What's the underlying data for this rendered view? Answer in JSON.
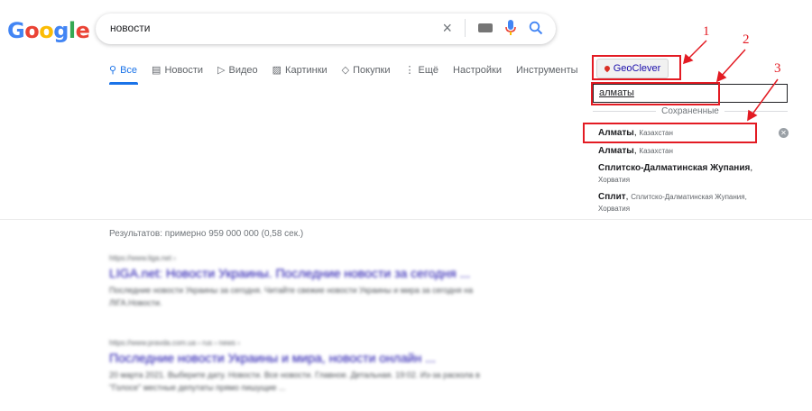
{
  "logo": {
    "letters": [
      "G",
      "o",
      "o",
      "g",
      "l",
      "e"
    ],
    "colors": [
      "#4285f4",
      "#ea4335",
      "#fbbc05",
      "#4285f4",
      "#34a853",
      "#ea4335"
    ]
  },
  "search": {
    "query": "новости",
    "icons": [
      "close-icon",
      "keyboard-icon",
      "microphone-icon",
      "search-icon"
    ]
  },
  "tabs": [
    {
      "label": "Все",
      "icon": "search-icon",
      "active": true
    },
    {
      "label": "Новости",
      "icon": "news-icon"
    },
    {
      "label": "Видео",
      "icon": "video-icon"
    },
    {
      "label": "Картинки",
      "icon": "image-icon"
    },
    {
      "label": "Покупки",
      "icon": "tag-icon"
    },
    {
      "label": "Ещё",
      "icon": "more-icon"
    },
    {
      "label": "Настройки"
    },
    {
      "label": "Инструменты"
    }
  ],
  "geoclever": {
    "button_label": "GeoClever",
    "input_value": "алматы",
    "saved_label": "Сохраненные",
    "suggestions": [
      {
        "main": "Алматы",
        "sub": "Казахстан"
      },
      {
        "main": "Алматы",
        "sub": "Казахстан"
      },
      {
        "main": "Сплитско-Далматинская Жупания",
        "sub": "Хорватия"
      },
      {
        "main": "Сплит",
        "sub": "Сплитско-Далматинская Жупания, Хорватия"
      }
    ],
    "remove_icon": "close-circle-icon"
  },
  "annotations": {
    "labels": [
      "1",
      "2",
      "3"
    ],
    "color": "#e31b23"
  },
  "results": {
    "stats": "Результатов: примерно 959 000 000 (0,58 сек.)",
    "items": [
      {
        "url": "https://www.liga.net ›",
        "title": "LIGA.net: Новости Украины. Последние новости за сегодня ...",
        "snippet": "Последние новости Украины за сегодня. Читайте свежие новости Украины и мира за сегодня на ЛІГА.Новости."
      },
      {
        "url": "https://www.pravda.com.ua › rus › news ›",
        "title": "Последние новости Украины и мира, новости онлайн ...",
        "snippet": "20 марта 2021. Выберите дату. Новости. Все новости. Главное. Детальная. 19:02. Из-за раскола в \"Голосе\" местные депутаты прямо пишущие ..."
      }
    ]
  }
}
